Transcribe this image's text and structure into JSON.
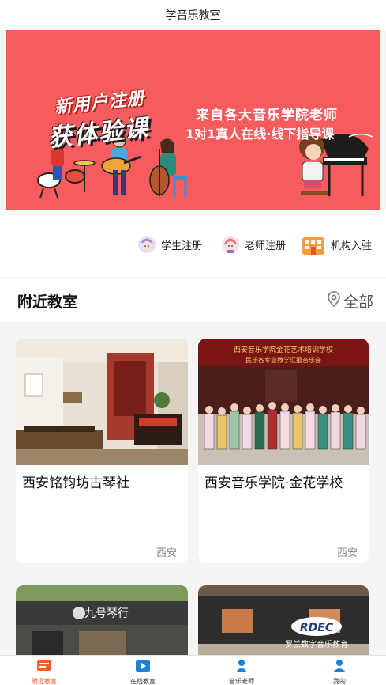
{
  "header": {
    "title": "学音乐教室"
  },
  "banner": {
    "line1": "新用户注册",
    "line2": "获体验课",
    "line3": "来自各大音乐学院老师",
    "line4": "1对1真人在线·线下指导课",
    "colors": {
      "background": "#f65c5e"
    }
  },
  "quick_actions": [
    {
      "label": "学生注册",
      "icon": "student-avatar-icon"
    },
    {
      "label": "老师注册",
      "icon": "teacher-avatar-icon"
    },
    {
      "label": "机构入驻",
      "icon": "building-icon"
    }
  ],
  "nearby": {
    "title": "附近教室",
    "filter_label": "全部",
    "filter_icon": "location-pin-icon"
  },
  "classrooms": [
    {
      "name": "西安铭钧坊古琴社",
      "city": "西安"
    },
    {
      "name": "西安音乐学院·金花学校",
      "city": "西安",
      "photo_text_1": "西安音乐学院金花艺术培训学校",
      "photo_text_2": "民乐各专业教学汇报音乐会"
    },
    {
      "name": "",
      "city": "",
      "photo_text": "九号琴行"
    },
    {
      "name": "",
      "city": "",
      "photo_text": "RDEC",
      "photo_text_2": "罗兰数字音乐教育"
    }
  ],
  "tabbar": {
    "items": [
      {
        "label": "附近教室",
        "icon": "classroom-icon",
        "active": true
      },
      {
        "label": "在线教室",
        "icon": "play-video-icon",
        "active": false
      },
      {
        "label": "音乐老师",
        "icon": "teacher-icon",
        "active": false
      },
      {
        "label": "我的",
        "icon": "user-profile-icon",
        "active": false
      }
    ],
    "colors": {
      "active": "#ff5a2c",
      "icon_blue": "#1e7fd6"
    }
  }
}
